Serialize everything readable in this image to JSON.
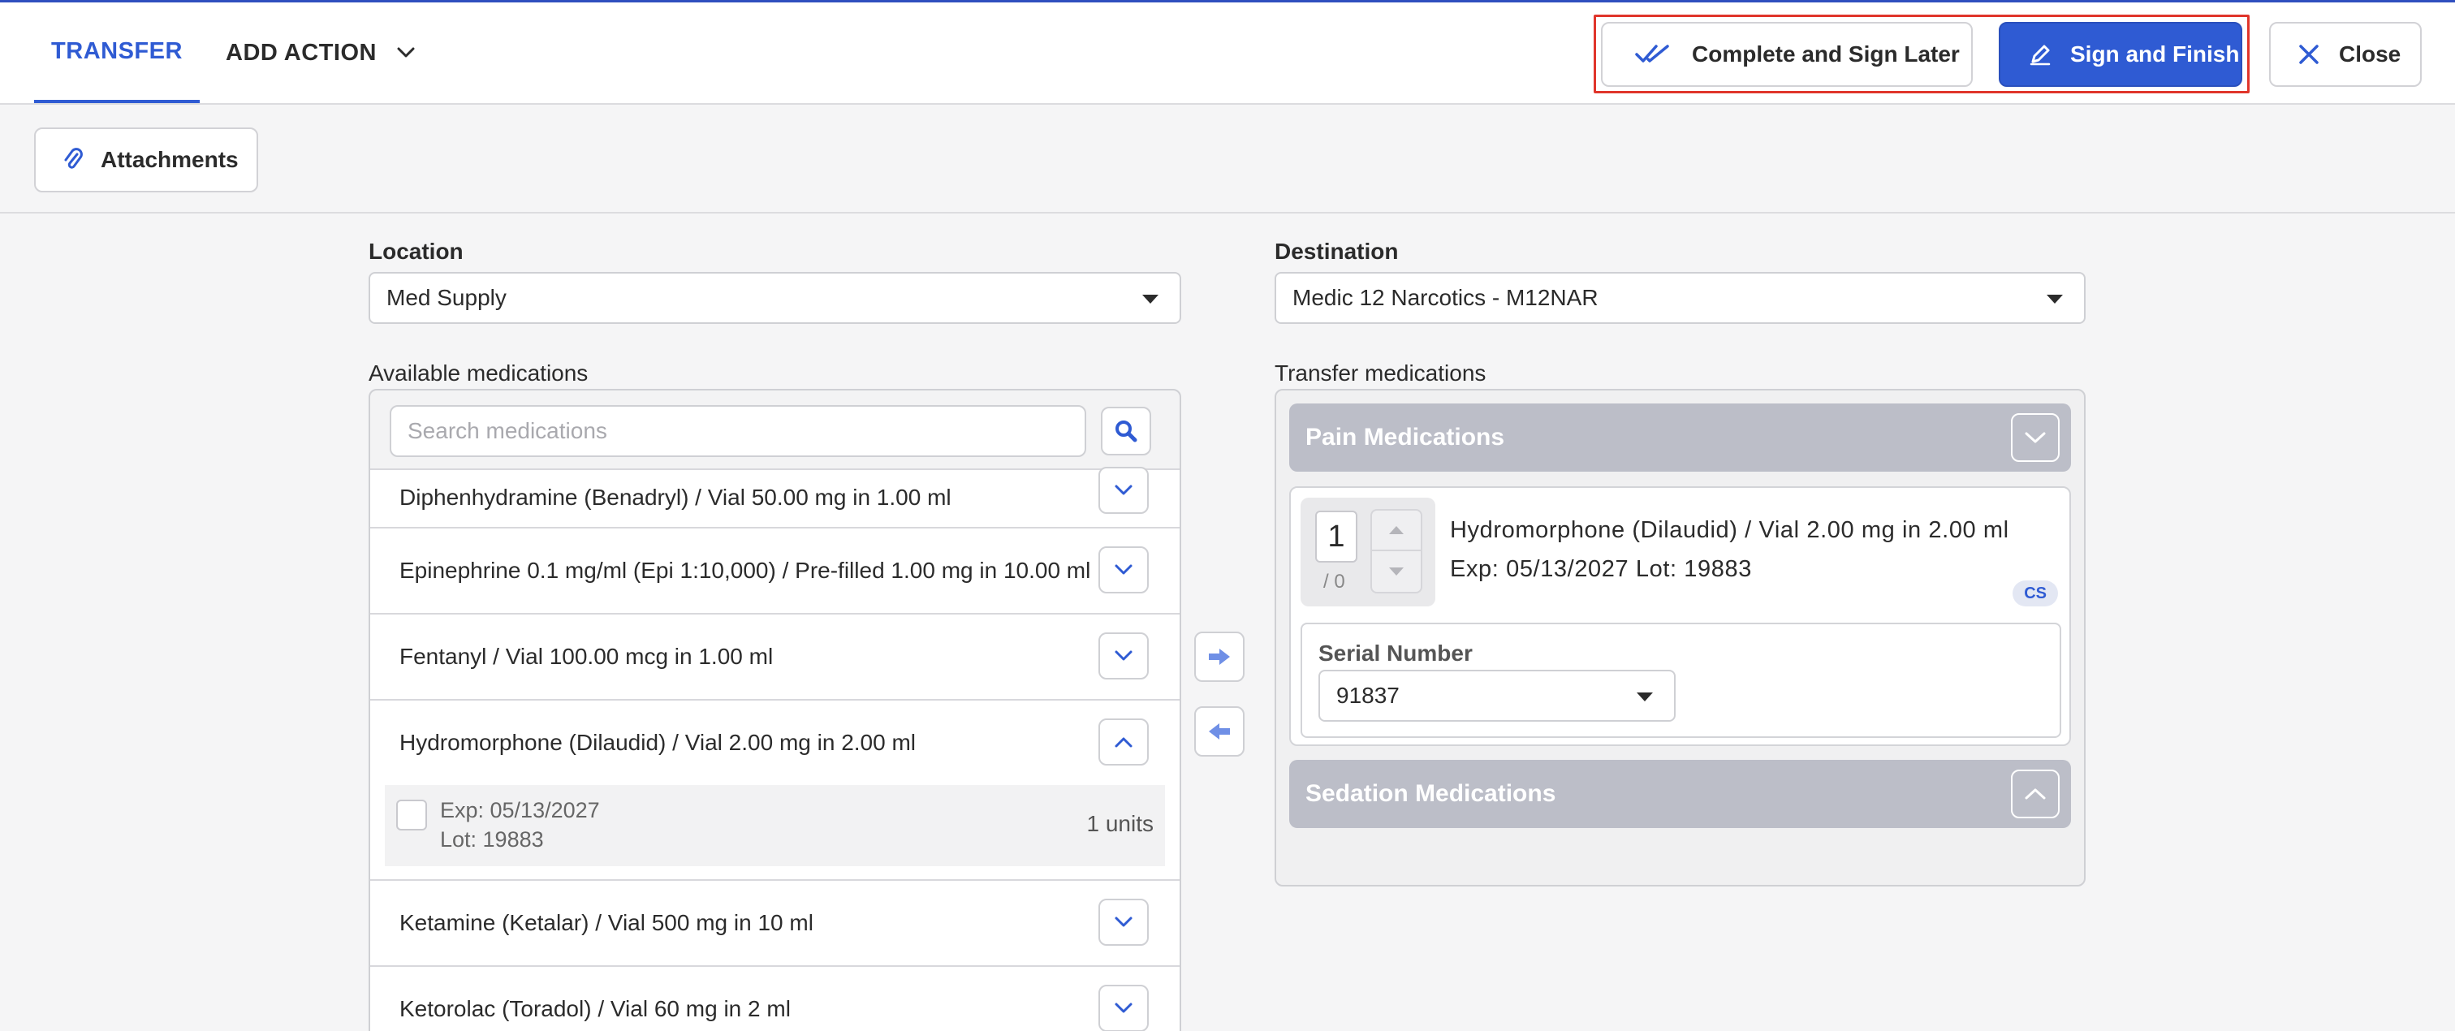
{
  "header": {
    "tabs": [
      {
        "label": "TRANSFER"
      },
      {
        "label": "ADD ACTION"
      }
    ],
    "actions": {
      "complete_later": "Complete and Sign Later",
      "sign_finish": "Sign and Finish",
      "close": "Close"
    }
  },
  "subheader": {
    "attachments": "Attachments"
  },
  "form": {
    "location_label": "Location",
    "location_value": "Med Supply",
    "destination_label": "Destination",
    "destination_value": "Medic 12 Narcotics - M12NAR",
    "available_label": "Available medications",
    "transfer_label": "Transfer medications"
  },
  "search": {
    "placeholder": "Search medications"
  },
  "available_medications": [
    {
      "name": "Diphenhydramine (Benadryl) / Vial 50.00 mg in 1.00 ml"
    },
    {
      "name": "Epinephrine 0.1 mg/ml (Epi 1:10,000) / Pre-filled 1.00 mg in 10.00 ml"
    },
    {
      "name": "Fentanyl / Vial 100.00 mcg in 1.00 ml"
    },
    {
      "name": "Hydromorphone (Dilaudid) / Vial 2.00 mg in 2.00 ml",
      "lot": {
        "exp": "Exp: 05/13/2027",
        "lot": "Lot: 19883",
        "units": "1 units"
      }
    },
    {
      "name": "Ketamine (Ketalar) / Vial 500 mg in 10 ml"
    },
    {
      "name": "Ketorolac (Toradol) / Vial 60 mg in 2 ml"
    }
  ],
  "transfer": {
    "groups": [
      {
        "name": "Pain Medications"
      },
      {
        "name": "Sedation Medications"
      }
    ],
    "item": {
      "qty": "1",
      "denom": "/ 0",
      "name": "Hydromorphone (Dilaudid) / Vial 2.00 mg in 2.00 ml",
      "exp_lot": "Exp: 05/13/2027 Lot: 19883",
      "badge": "CS",
      "serial_label": "Serial Number",
      "serial_value": "91837"
    }
  },
  "colors": {
    "accent": "#2f5bd3",
    "highlight": "#e0352b",
    "group_header": "#bcbec8"
  }
}
